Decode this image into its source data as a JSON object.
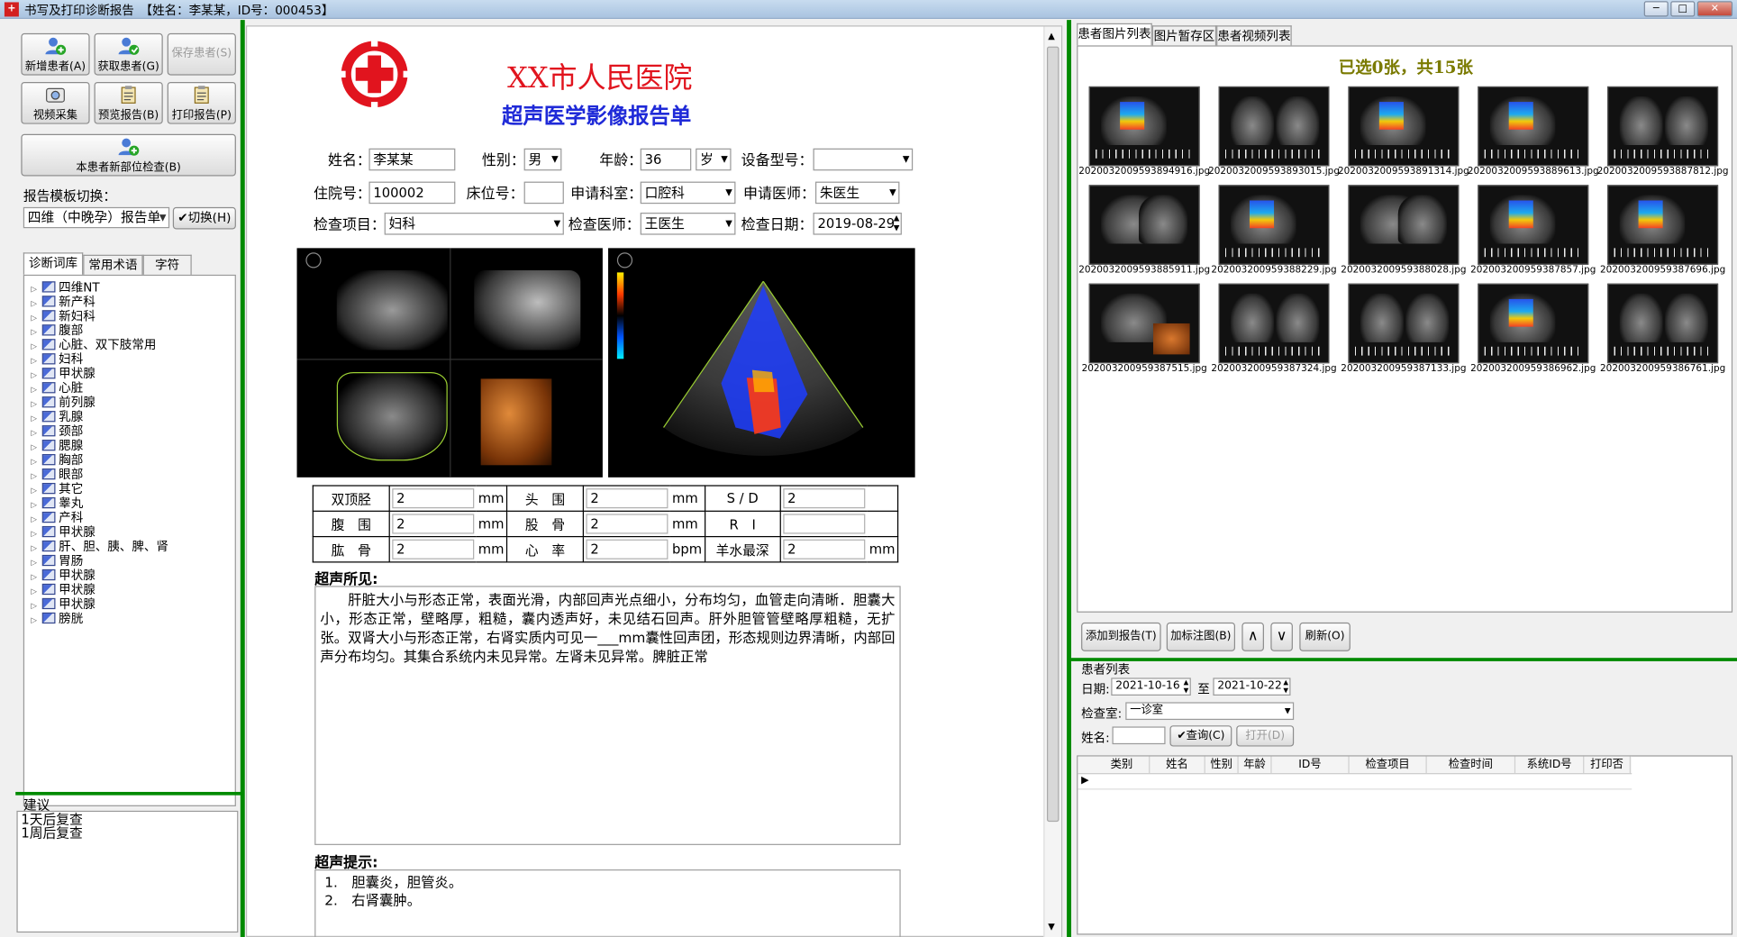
{
  "window": {
    "title": "书写及打印诊断报告",
    "subtitle": "【姓名：李某某，ID号：000453】",
    "min": "─",
    "max": "□",
    "close": "✕"
  },
  "toolbar": {
    "new_patient": "新增患者(A)",
    "get_patient": "获取患者(G)",
    "save_patient": "保存患者(S)",
    "video_capture": "视频采集",
    "preview_report": "预览报告(B)",
    "print_report": "打印报告(P)",
    "new_site_check": "本患者新部位检查(B)"
  },
  "template": {
    "label": "报告模板切换：",
    "selected": "四维（中晚孕）报告单",
    "switch_btn": "切换(H)"
  },
  "left_tabs": [
    "诊断词库",
    "常用术语",
    "字符"
  ],
  "tree_items": [
    "四维NT",
    "新产科",
    "新妇科",
    "腹部",
    "心脏、双下肢常用",
    "妇科",
    "甲状腺",
    "心脏",
    "前列腺",
    "乳腺",
    "颈部",
    "腮腺",
    "胸部",
    "眼部",
    "其它",
    "睾丸",
    "产科",
    "甲状腺",
    "肝、胆、胰、脾、肾",
    "胃肠",
    "甲状腺",
    "甲状腺",
    "甲状腺",
    "膀胱"
  ],
  "advice": {
    "label": "建议",
    "lines": [
      "1天后复查",
      "1周后复查"
    ]
  },
  "report": {
    "hospital": "XX市人民医院",
    "title": "超声医学影像报告单",
    "fields": {
      "name_label": "姓名：",
      "name": "李某某",
      "gender_label": "性别：",
      "gender": "男",
      "age_label": "年龄：",
      "age": "36",
      "age_unit": "岁",
      "device_label": "设备型号：",
      "device": "",
      "admission_label": "住院号：",
      "admission": "100002",
      "bed_label": "床位号：",
      "bed": "",
      "dept_label": "申请科室：",
      "dept": "口腔科",
      "req_doctor_label": "申请医师：",
      "req_doctor": "朱医生",
      "item_label": "检查项目：",
      "item": "妇科",
      "exam_doctor_label": "检查医师：",
      "exam_doctor": "王医生",
      "date_label": "检查日期：",
      "date": "2019-08-29"
    },
    "measurements": [
      [
        {
          "label": "双顶胫",
          "value": "2",
          "unit": "mm"
        },
        {
          "label": "头　围",
          "value": "2",
          "unit": "mm"
        },
        {
          "label": "S / D",
          "value": "2",
          "unit": ""
        }
      ],
      [
        {
          "label": "腹　围",
          "value": "2",
          "unit": "mm"
        },
        {
          "label": "股　骨",
          "value": "2",
          "unit": "mm"
        },
        {
          "label": "R　I",
          "value": "",
          "unit": ""
        }
      ],
      [
        {
          "label": "肱　骨",
          "value": "2",
          "unit": "mm"
        },
        {
          "label": "心　率",
          "value": "2",
          "unit": "bpm"
        },
        {
          "label": "羊水最深",
          "value": "2",
          "unit": "mm"
        }
      ]
    ],
    "findings_label": "超声所见:",
    "findings": "肝脏大小与形态正常，表面光滑，内部回声光点细小，分布均匀，血管走向清晰．胆囊大小，形态正常，壁略厚，粗糙，囊内透声好，未见结石回声。肝外胆管管壁略厚粗糙，无扩张。双肾大小与形态正常，右肾实质内可见一___mm囊性回声团，形态规则边界清晰，内部回声分布均匀。其集合系统内未见异常。左肾未见异常。脾脏正常",
    "hint_label": "超声提示:",
    "hints": [
      "1.　胆囊炎，胆管炎。",
      "2.　右肾囊肿。"
    ]
  },
  "right_tabs": [
    "患者图片列表",
    "图片暂存区",
    "患者视频列表"
  ],
  "images": {
    "summary": "已选0张，共15张",
    "files": [
      "20200320095938949​16.jpg",
      "202003200959389​3015.jpg",
      "20200320095938913​14.jpg",
      "20200320095938896​13.jpg",
      "20200320095938878​12.jpg",
      "20200320095938859​11.jpg",
      "20200320095938822​9.jpg",
      "20200320095938802​8.jpg",
      "20200320095938785​7.jpg",
      "20200320095938769​6.jpg",
      "20200320095938751​5.jpg",
      "20200320095938732​4.jpg",
      "20200320095938713​3.jpg",
      "20200320095938696​2.jpg",
      "20200320095938676​1.jpg"
    ],
    "kinds": [
      "cf",
      "split",
      "cf",
      "cf",
      "split",
      "gray",
      "cf",
      "gray",
      "cf",
      "cf",
      "orange",
      "split",
      "split",
      "cf",
      "split"
    ],
    "buttons": {
      "add": "添加到报告(T)",
      "annotate": "加标注图(B)",
      "up": "∧",
      "down": "∨",
      "refresh": "刷新(O)"
    }
  },
  "patients": {
    "label": "患者列表",
    "date_label": "日期:",
    "date_from": "2021-10-16",
    "to_label": "至",
    "date_to": "2021-10-22",
    "room_label": "检查室:",
    "room": "一诊室",
    "name_label": "姓名:",
    "name": "",
    "query_btn": "查询(C)",
    "open_btn": "打开(D)",
    "columns": [
      "类别",
      "姓名",
      "性别",
      "年龄",
      "ID号",
      "检查项目",
      "检查时间",
      "系统ID号",
      "打印否"
    ]
  },
  "colors": {
    "accent_green": "#008a00",
    "hospital_red": "#e1141e",
    "title_blue": "#1f2ad8",
    "olive": "#7a7a00"
  }
}
